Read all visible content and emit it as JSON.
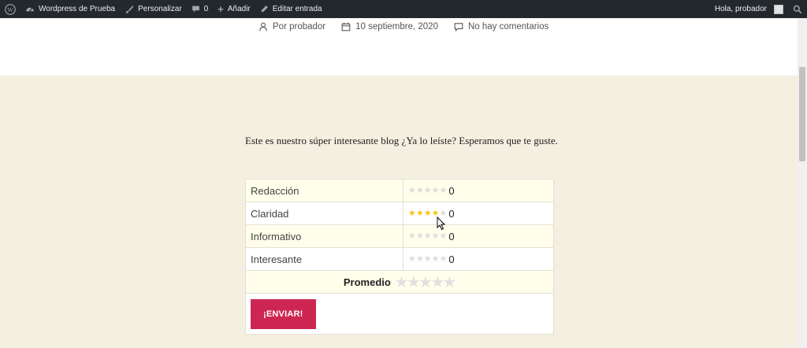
{
  "adminbar": {
    "site_name": "Wordpress de Prueba",
    "customize": "Personalizar",
    "comments_count": "0",
    "add_new": "Añadir",
    "edit_post": "Editar entrada",
    "greeting": "Hola, probador"
  },
  "post_meta": {
    "author": "Por probador",
    "date": "10 septiembre, 2020",
    "comments": "No hay comentarios"
  },
  "content": {
    "paragraph": "Este es nuestro súper interesante blog ¿Ya lo leíste? Esperamos que te guste."
  },
  "rating": {
    "rows": [
      {
        "label": "Redacción",
        "stars_filled": 0,
        "score": "0"
      },
      {
        "label": "Claridad",
        "stars_filled": 4,
        "score": "0"
      },
      {
        "label": "Informativo",
        "stars_filled": 0,
        "score": "0"
      },
      {
        "label": "Interesante",
        "stars_filled": 0,
        "score": "0"
      }
    ],
    "average_label": "Promedio",
    "average_stars": 0,
    "submit_label": "¡ENVIAR!"
  },
  "colors": {
    "adminbar_bg": "#23282d",
    "page_bg": "#f4efe1",
    "accent": "#cd2653",
    "star_on": "#f5c518",
    "star_off": "#dcdcdc"
  }
}
